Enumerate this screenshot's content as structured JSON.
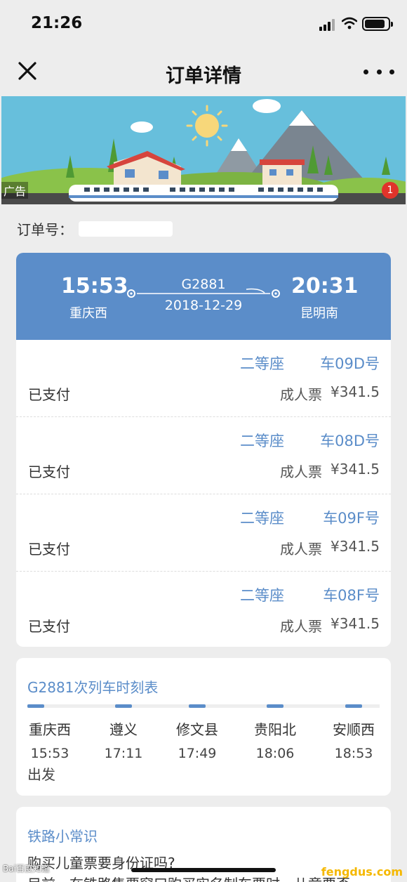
{
  "status_bar": {
    "time": "21:26"
  },
  "nav": {
    "title": "订单详情"
  },
  "banner": {
    "ad_label": "广告",
    "ad_count": "1"
  },
  "order": {
    "label": "订单号："
  },
  "trip": {
    "dep_time": "15:53",
    "dep_station": "重庆西",
    "arr_time": "20:31",
    "arr_station": "昆明南",
    "train_no": "G2881",
    "date": "2018-12-29"
  },
  "passengers": [
    {
      "seat_class": "二等座",
      "seat_no": "车09D号",
      "status": "已支付",
      "ticket_type": "成人票",
      "price": "¥341.5"
    },
    {
      "seat_class": "二等座",
      "seat_no": "车08D号",
      "status": "已支付",
      "ticket_type": "成人票",
      "price": "¥341.5"
    },
    {
      "seat_class": "二等座",
      "seat_no": "车09F号",
      "status": "已支付",
      "ticket_type": "成人票",
      "price": "¥341.5"
    },
    {
      "seat_class": "二等座",
      "seat_no": "车08F号",
      "status": "已支付",
      "ticket_type": "成人票",
      "price": "¥341.5"
    }
  ],
  "schedule": {
    "title": "G2881次列车时刻表",
    "stops": [
      {
        "name": "重庆西",
        "time": "15:53"
      },
      {
        "name": "遵义",
        "time": "17:11"
      },
      {
        "name": "修文县",
        "time": "17:49"
      },
      {
        "name": "贵阳北",
        "time": "18:06"
      },
      {
        "name": "安顺西",
        "time": "18:53"
      }
    ],
    "depart_note": "出发"
  },
  "tips": {
    "title": "铁路小常识",
    "question": "购买儿童票要身份证吗?",
    "answer": "目前，在铁路售票窗口购买实名制车票时，儿童要否"
  },
  "watermarks": {
    "left": "Bai百度知道",
    "right": "fengdus.com"
  },
  "colors": {
    "accent": "#5b8dc9",
    "background": "#ededed",
    "badge": "#e0342b"
  }
}
